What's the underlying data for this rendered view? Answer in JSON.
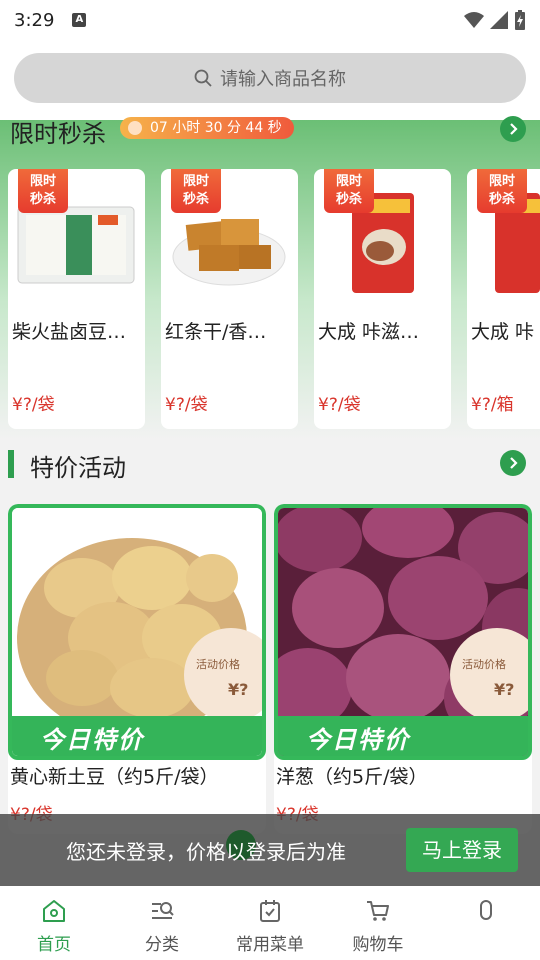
{
  "status": {
    "time": "3:29",
    "notif_letter": "A"
  },
  "search": {
    "placeholder": "请输入商品名称"
  },
  "flash_sale": {
    "title": "限时秒杀",
    "countdown": "07 小时 30 分 44 秒",
    "tag_line1": "限时",
    "tag_line2": "秒杀",
    "items": [
      {
        "name": "柴火盐卤豆…",
        "price": "¥?/袋"
      },
      {
        "name": "红条干/香…",
        "price": "¥?/袋"
      },
      {
        "name": "大成 咔滋…",
        "price": "¥?/袋"
      },
      {
        "name": "大成 咔",
        "price": "¥?/箱"
      }
    ]
  },
  "special": {
    "title": "特价活动",
    "banner": "今日特价",
    "badge_label": "活动价格",
    "badge_value": "¥?",
    "items": [
      {
        "name": "黄心新土豆（约5斤/袋）",
        "price": "¥?/袋"
      },
      {
        "name": "洋葱（约5斤/袋）",
        "price": "¥?/袋"
      }
    ]
  },
  "login_banner": {
    "text": "您还未登录，价格以登录后为准",
    "button": "马上登录"
  },
  "nav": {
    "items": [
      {
        "label": "首页",
        "icon": "home-icon",
        "active": true
      },
      {
        "label": "分类",
        "icon": "category-search-icon",
        "active": false
      },
      {
        "label": "常用菜单",
        "icon": "clipboard-check-icon",
        "active": false
      },
      {
        "label": "购物车",
        "icon": "cart-icon",
        "active": false
      },
      {
        "label": "",
        "icon": "user-icon",
        "active": false
      }
    ]
  },
  "colors": {
    "accent": "#2e9e4f",
    "price": "#d9352c",
    "flash_tag": "#e63b2e"
  }
}
